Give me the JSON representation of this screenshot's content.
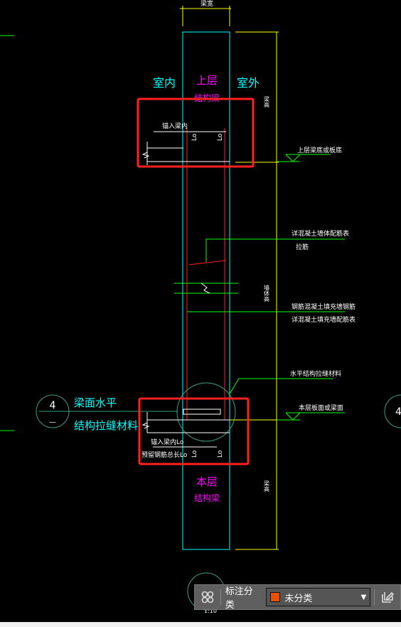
{
  "drawing": {
    "beam_width": "梁宽",
    "indoor": "室内",
    "outdoor": "室外",
    "upper_beam_line1": "上层",
    "upper_beam_line2": "结构梁",
    "beam_height_top": "梁高",
    "beam_height_bottom": "梁高",
    "wall_height": "墙体高",
    "anchor_top": "锚入梁内",
    "lo": "Lo",
    "upper_level_label": "上层梁底或板底",
    "note1_line1": "详混凝土墙体配筋表",
    "note1_line2": "拉筋",
    "note2_line1": "钢筋混凝土填充墙钢筋",
    "note2_line2": "详混凝土填充墙配筋表",
    "note3": "水平结构拉缝材料",
    "note4": "本层板面或梁面",
    "callout_line1": "梁面水平",
    "callout_line2": "结构拉缝材料",
    "detail_number": "4",
    "detail_sheet": "—",
    "anchor_bottom": "锚入梁内Lo",
    "total_length": "预留钢筋总长Lo",
    "lower_beam_line1": "本层",
    "lower_beam_line2": "结构梁",
    "scale": "1:10"
  },
  "toolbar": {
    "grid_icon": "four-circles-icon",
    "category_label": "标注分类",
    "category_value": "未分类",
    "category_color": "#e65100",
    "edit_icon": "edit-icon"
  }
}
